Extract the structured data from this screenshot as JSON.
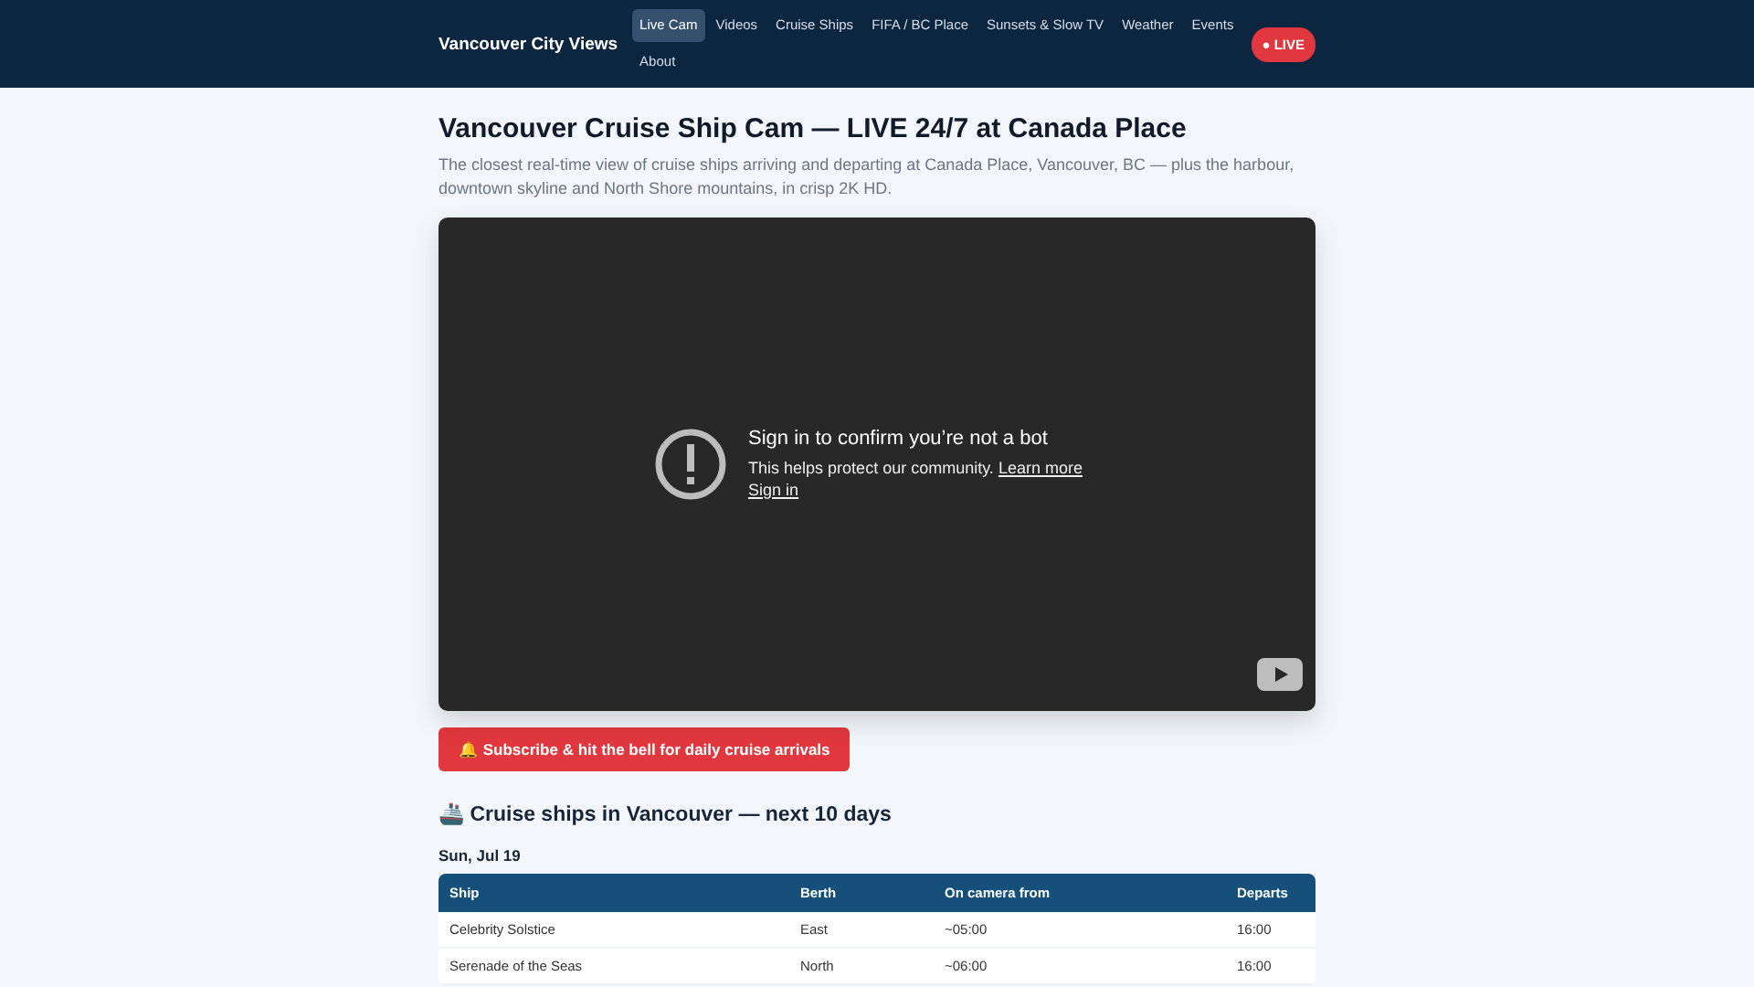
{
  "header": {
    "brand": "Vancouver City Views",
    "nav": [
      {
        "label": "Live Cam",
        "selected": true
      },
      {
        "label": "Videos",
        "selected": false
      },
      {
        "label": "Cruise Ships",
        "selected": false
      },
      {
        "label": "FIFA / BC Place",
        "selected": false
      },
      {
        "label": "Sunsets & Slow TV",
        "selected": false
      },
      {
        "label": "Weather",
        "selected": false
      },
      {
        "label": "Events",
        "selected": false
      },
      {
        "label": "About",
        "selected": false
      }
    ],
    "live_badge": "● LIVE"
  },
  "title": "Vancouver Cruise Ship Cam — LIVE 24/7 at Canada Place",
  "intro": "The closest real-time view of cruise ships arriving and departing at Canada Place, Vancouver, BC — plus the harbour, downtown skyline and North Shore mountains, in crisp 2K HD.",
  "video": {
    "heading": "Sign in to confirm you’re not a bot",
    "message": "This helps protect our community.",
    "learn_more": "Learn more",
    "sign_in": "Sign in"
  },
  "subscribe_button": "🔔 Subscribe & hit the bell for daily cruise arrivals",
  "schedule": {
    "heading": "🚢 Cruise ships in Vancouver — next 10 days",
    "date": "Sun, Jul 19",
    "columns": [
      "Ship",
      "Berth",
      "On camera from",
      "Departs"
    ],
    "rows": [
      [
        "Celebrity Solstice",
        "East",
        "~05:00",
        "16:00"
      ],
      [
        "Serenade of the Seas",
        "North",
        "~06:00",
        "16:00"
      ]
    ]
  }
}
